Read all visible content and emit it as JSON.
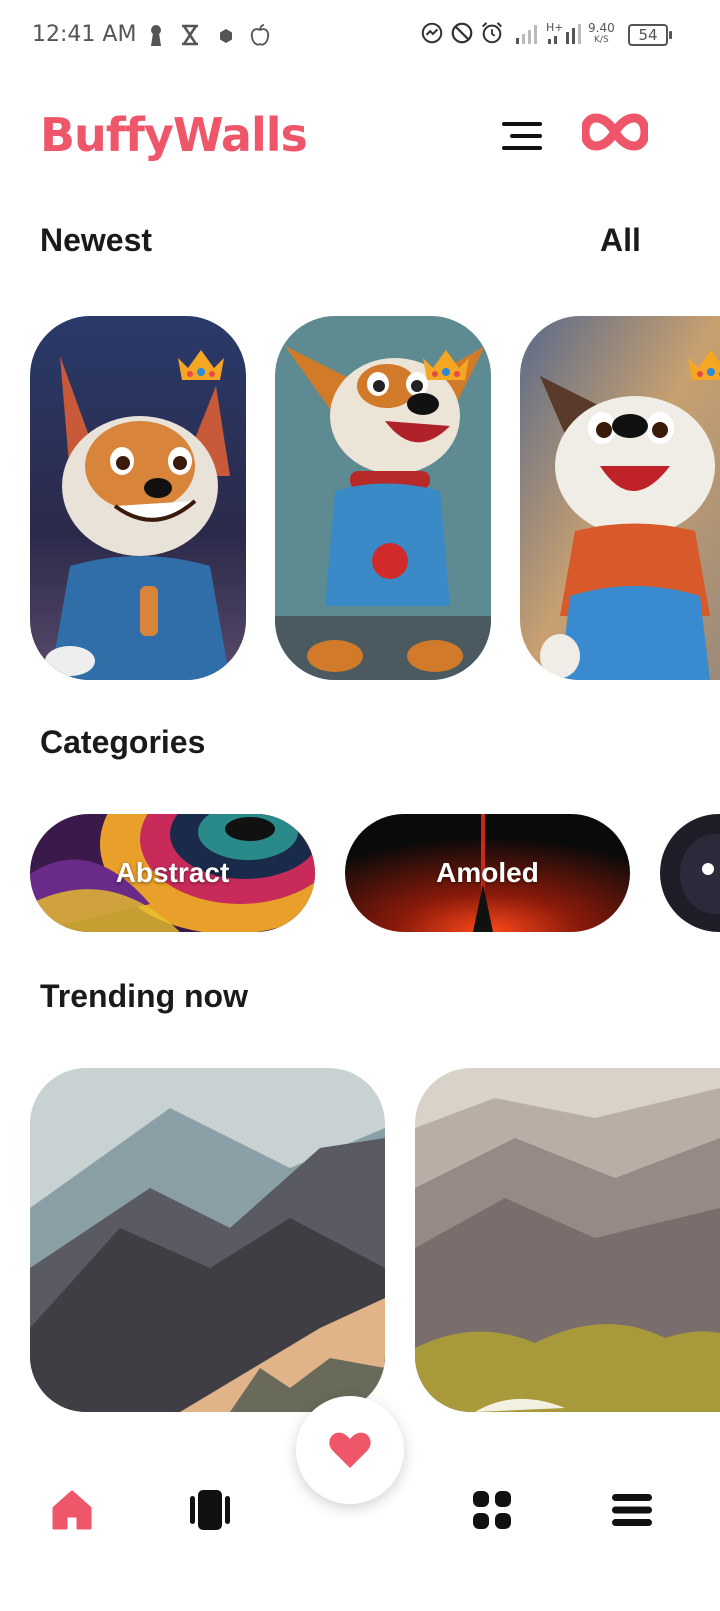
{
  "status_bar": {
    "time": "12:41 AM",
    "net_speed_value": "9.40",
    "net_speed_unit": "K/S",
    "battery": "54",
    "icons": [
      "keyhole-icon",
      "hourglass-icon",
      "hexagon-icon",
      "apple-icon",
      "sync-icon",
      "do-not-disturb-icon",
      "alarm-icon",
      "signal-icon",
      "hplus-signal-icon"
    ]
  },
  "header": {
    "brand": "BuffyWalls",
    "brand_color": "#f0566a",
    "menu_icon": "menu-icon",
    "premium_icon": "infinity-icon"
  },
  "newest": {
    "title": "Newest",
    "all_label": "All",
    "cards": [
      {
        "name": "puppy-wallpaper-1",
        "premium": true
      },
      {
        "name": "puppy-wallpaper-2",
        "premium": true
      },
      {
        "name": "puppy-wallpaper-3",
        "premium": true
      }
    ]
  },
  "categories": {
    "title": "Categories",
    "items": [
      {
        "label": "Abstract"
      },
      {
        "label": "Amoled"
      },
      {
        "label": ""
      }
    ]
  },
  "trending": {
    "title": "Trending now",
    "items": [
      "mountain-wallpaper-1",
      "mountain-wallpaper-2"
    ]
  },
  "bottom_nav": {
    "items": [
      "home-icon",
      "wallpapers-icon",
      "favorites-icon",
      "categories-icon",
      "more-icon"
    ],
    "active": "home-icon",
    "accent": "#f0566a"
  }
}
